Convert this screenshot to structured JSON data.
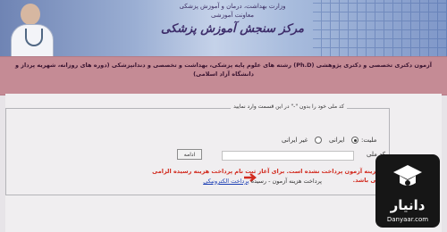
{
  "banner": {
    "line1": "وزارت بهداشت، درمان و آموزش پزشکی",
    "line2": "معاونت آموزشی",
    "title": "مرکز سنجش آموزش پزشکی"
  },
  "heading": {
    "text": "آزمون دکتری تخصصی و دکتری پژوهشی (Ph.D) رشته های علوم پایه پزشکی، بهداشت و تخصصی و دندانپزشکی (دوره های روزانه، شهریه پرداز و دانشگاه آزاد اسلامی)"
  },
  "form": {
    "legend": "کد ملی خود را بدون \"-\" در این قسمت وارد نمایید",
    "nationality_label": "ملیت:",
    "options": [
      "ایرانی",
      "غیر ایرانی"
    ],
    "selected_option": "ایرانی",
    "national_code_label": "کد ملی",
    "national_code_value": "",
    "continue_button": "ادامه"
  },
  "notice": {
    "warning": "هزینه آزمون پرداخت نشده است. برای آغاز ثبت نام پرداخت هزینه رسیده الزامی می باشد.",
    "prefix": "پرداخت هزینه آزمون - رسیده",
    "link": "پرداخت الکترونیکی"
  },
  "watermark": {
    "name": "دانیار",
    "site": "Danyaar.com"
  },
  "colors": {
    "heading_band": "#c58b95",
    "warning": "#d22a1e",
    "link": "#1c3fb4"
  }
}
